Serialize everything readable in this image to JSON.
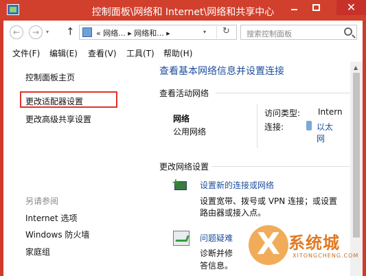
{
  "window": {
    "title": "控制面板\\网络和 Internet\\网络和共享中心",
    "controls": {
      "minimize": "",
      "maximize": "",
      "close": "✕"
    }
  },
  "address_bar": {
    "back_icon": "back-arrow-icon",
    "forward_icon": "forward-arrow-icon",
    "up_icon": "up-arrow-icon",
    "path": "«  网络...  ▸  网络和...  ▸",
    "refresh_icon": "refresh-icon",
    "search_placeholder": "搜索控制面板"
  },
  "menu": [
    "文件(F)",
    "编辑(E)",
    "查看(V)",
    "工具(T)",
    "帮助(H)"
  ],
  "sidebar": {
    "home": "控制面板主页",
    "adapter_settings": "更改适配器设置",
    "advanced_sharing": "更改高级共享设置",
    "see_also_title": "另请参阅",
    "see_also": [
      "Internet 选项",
      "Windows 防火墙",
      "家庭组"
    ]
  },
  "main": {
    "title": "查看基本网络信息并设置连接",
    "active_networks_label": "查看活动网络",
    "network": {
      "name": "网络",
      "category": "公用网络",
      "access_type_label": "访问类型:",
      "access_type_value": "Internet",
      "connections_label": "连接:",
      "connection_value_line1": "以太",
      "connection_value_line2": "网"
    },
    "change_settings_label": "更改网络设置",
    "actions": [
      {
        "label": "设置新的连接或网络",
        "desc_line1": "设置宽带、拨号或 VPN 连接；或设置",
        "desc_line2": "路由器或接入点。"
      },
      {
        "label": "问题疑难",
        "desc_line1": "诊断并修",
        "desc_line2": "答信息。"
      }
    ]
  },
  "watermark": {
    "text": "系统城",
    "sub": "XITONGCHENG.COM"
  },
  "colors": {
    "titlebar": "#d1402d",
    "link": "#1e4e9c",
    "highlight": "#e0312a"
  }
}
